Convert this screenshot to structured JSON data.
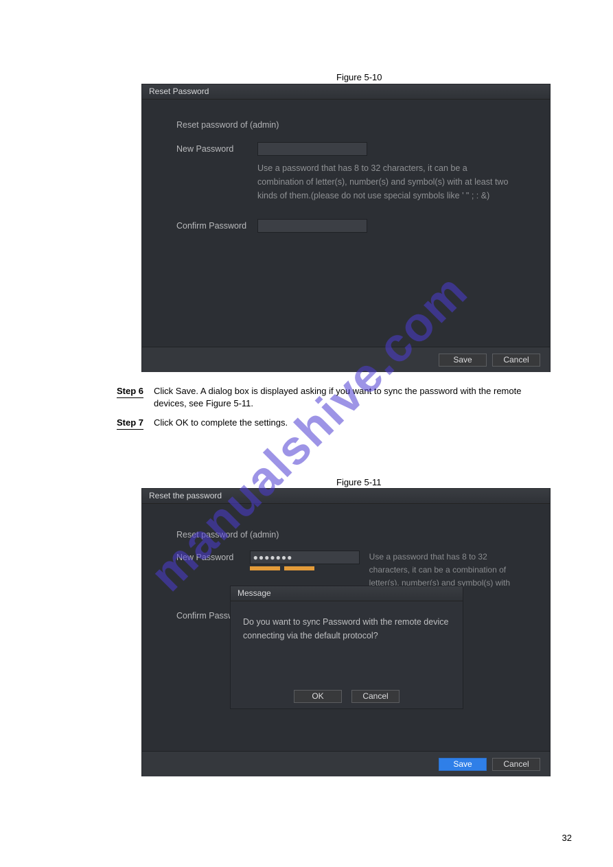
{
  "figure1_label": "Figure 5-10",
  "dialog1": {
    "title": "Reset Password",
    "subtitle": "Reset password of (admin)",
    "new_password_label": "New Password",
    "confirm_password_label": "Confirm Password",
    "password_hint": "Use a password that has 8 to 32 characters, it can be a combination of letter(s), number(s) and symbol(s) with at least two kinds of them.(please do not use special symbols like ' \" ; : &)",
    "save": "Save",
    "cancel": "Cancel"
  },
  "step6": {
    "label": "Step 6",
    "text": "Click Save. A dialog box is displayed asking if you want to sync the password with the remote devices, see Figure 5-11."
  },
  "step7": {
    "label": "Step 7",
    "text": "Click OK to complete the settings."
  },
  "figure2_label": "Figure 5-11",
  "dialog2": {
    "title": "Reset the password",
    "subtitle": "Reset password of (admin)",
    "new_password_label": "New Password",
    "confirm_password_label": "Confirm Passw",
    "new_password_value": "●●●●●●●",
    "password_hint": "Use a password that has 8 to 32 characters, it can be a combination of letter(s), number(s) and symbol(s) with at",
    "save": "Save",
    "cancel": "Cancel"
  },
  "message_dialog": {
    "title": "Message",
    "body": "Do you want to sync Password with the remote device connecting via the default protocol?",
    "ok": "OK",
    "cancel": "Cancel"
  },
  "watermark": "manualshive.com",
  "page_number": "32"
}
